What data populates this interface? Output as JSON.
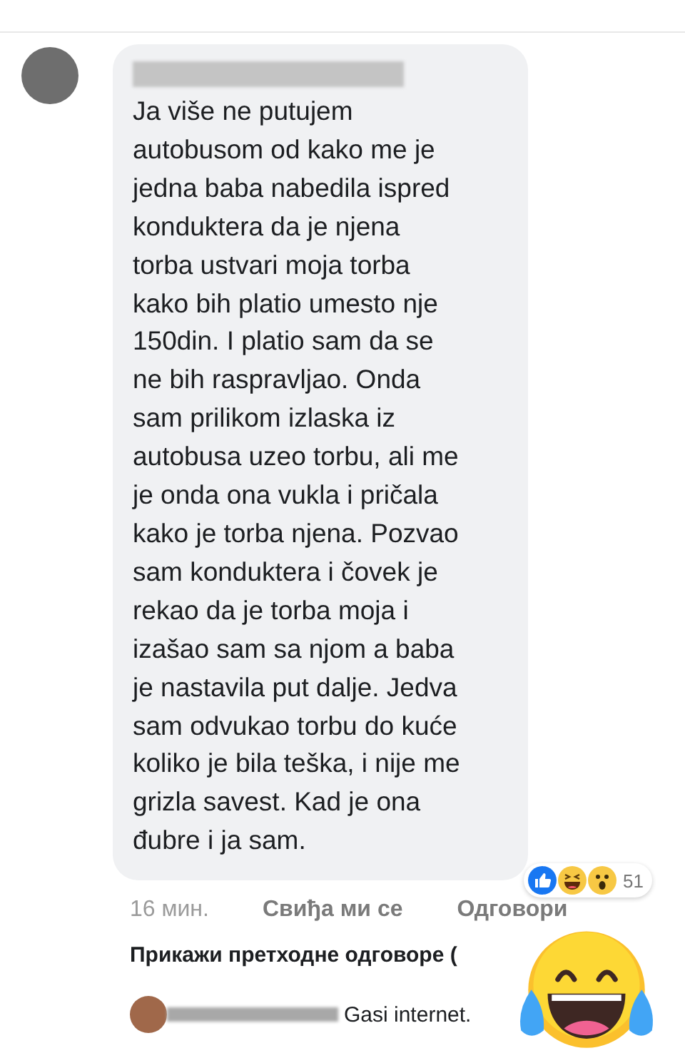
{
  "comment": {
    "lines": [
      "Ja više ne putujem",
      "autobusom od kako me je",
      "jedna baba nabedila ispred",
      "konduktera da je njena",
      "torba ustvari moja torba",
      "kako bih platio umesto nje",
      "150din. I platio sam da se",
      "ne bih raspravljao. Onda",
      "sam prilikom izlaska iz",
      "autobusa uzeo torbu, ali me",
      "je onda ona vukla i pričala",
      "kako je torba njena. Pozvao",
      "sam konduktera i čovek je",
      "rekao da je torba moja i",
      "izašao sam sa njom a baba",
      "je nastavila put dalje. Jedva",
      "sam odvukao torbu do kuće",
      "koliko je bila teška, i nije me",
      "grizla savest. Kad je ona",
      "đubre i ja sam."
    ],
    "reaction_count": "51",
    "time": "16 мин.",
    "like": "Свиђа ми се",
    "reply": "Одговори"
  },
  "show_replies": "Прикажи претходне одговоре (",
  "reply_preview": {
    "text": "Gasi internet."
  }
}
